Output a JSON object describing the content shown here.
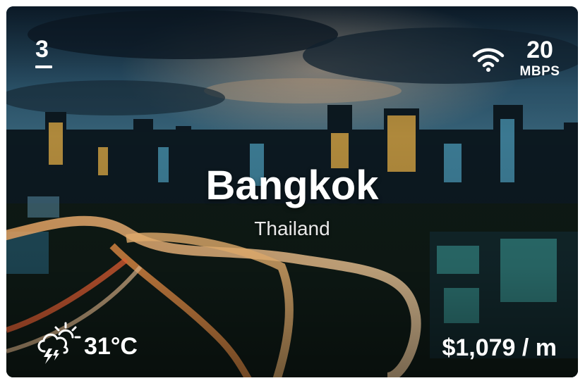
{
  "card": {
    "rank": "3",
    "internet": {
      "speed_value": "20",
      "speed_unit": "MBPS",
      "icon": "wifi-icon"
    },
    "city": "Bangkok",
    "country": "Thailand",
    "weather": {
      "icon": "thunderstorm-icon",
      "temperature": "31°C"
    },
    "cost": "$1,079 / m"
  },
  "colors": {
    "text": "#ffffff",
    "sky": "#1c3a52",
    "city_lights": "#f2b84a"
  }
}
